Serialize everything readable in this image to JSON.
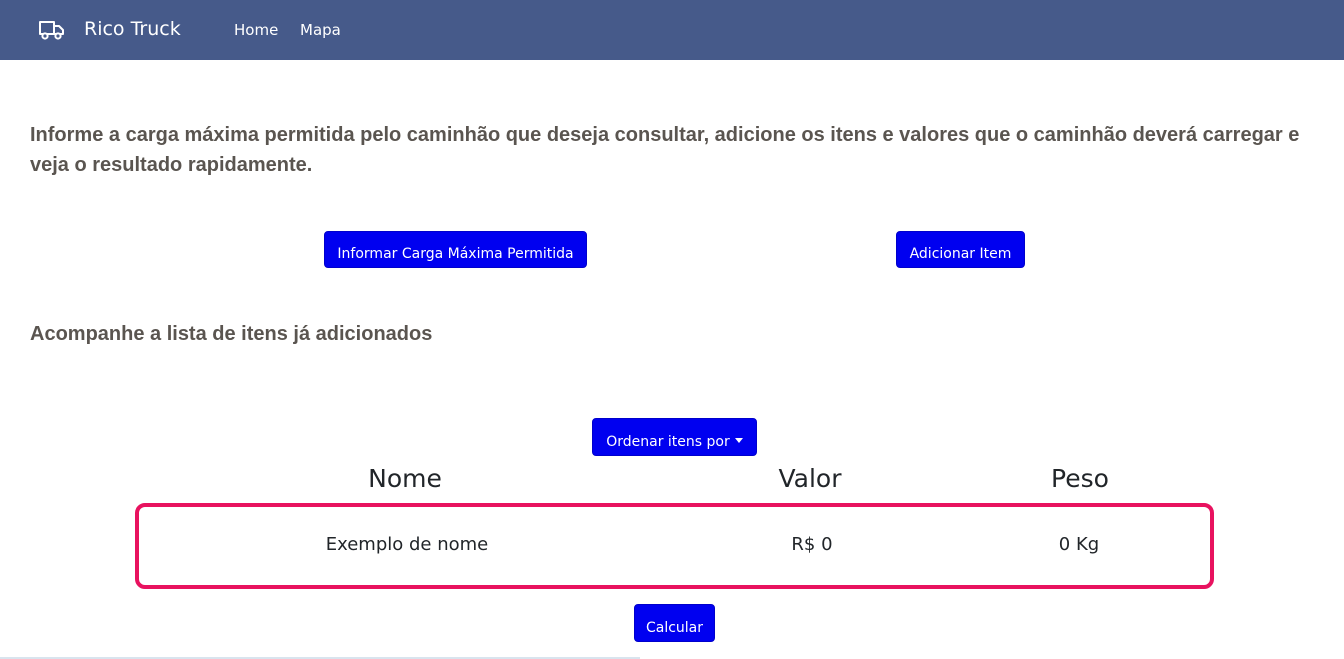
{
  "navbar": {
    "brand": "Rico Truck",
    "brand_icon": "truck-icon",
    "links": [
      "Home",
      "Mapa"
    ],
    "background": "#465a8a"
  },
  "intro": {
    "text": "Informe a carga máxima permitida pelo caminhão que deseja consultar, adicione os itens e valores que o caminhão deverá carregar e veja o resultado rapidamente."
  },
  "actions": {
    "informar_carga": "Informar Carga Máxima Permitida",
    "adicionar_item": "Adicionar Item"
  },
  "list": {
    "title": "Acompanhe a lista de itens já adicionados",
    "sort_button": "Ordenar itens por",
    "columns": [
      "Nome",
      "Valor",
      "Peso"
    ],
    "items": [
      {
        "nome": "Exemplo de nome",
        "valor": "R$ 0",
        "peso": "0 Kg"
      }
    ],
    "highlight_color": "#e8125f"
  },
  "calculate_button": "Calcular",
  "colors": {
    "button": "#0000f0",
    "heading_text": "#5a5550"
  }
}
